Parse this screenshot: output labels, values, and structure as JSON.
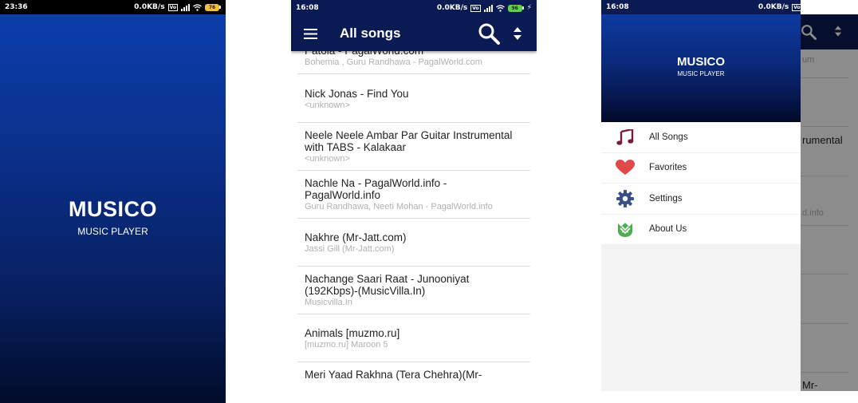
{
  "splash": {
    "status": {
      "time": "23:36",
      "speed": "0.0KB/s",
      "volte": "Vo",
      "battery": "76"
    },
    "title": "MUSICO",
    "subtitle": "MUSIC PLAYER"
  },
  "list": {
    "status": {
      "time": "16:08",
      "speed": "0.0KB/s",
      "volte": "Vo",
      "battery": "96"
    },
    "appbar": {
      "title": "All songs",
      "menu_icon": "hamburger-icon",
      "search_icon": "search-icon",
      "sort_icon": "sort-icon"
    },
    "songs": [
      {
        "title": "Patola - PagalWorld.com",
        "artist": "Bohemia , Guru Randhawa - PagalWorld.com"
      },
      {
        "title": "Nick Jonas - Find You",
        "artist": "<unknown>"
      },
      {
        "title": "Neele Neele Ambar Par Guitar Instrumental with TABS - Kalakaar",
        "artist": "<unknown>"
      },
      {
        "title": "Nachle Na - PagalWorld.info - PagalWorld.info",
        "artist": "Guru Randhawa, Neeti Mohan - PagalWorld.info"
      },
      {
        "title": "Nakhre (Mr-Jatt.com)",
        "artist": "Jassi Gill (Mr-Jatt.com)"
      },
      {
        "title": "Nachange Saari Raat - Junooniyat (192Kbps)-(MusicVilla.In)",
        "artist": "Musicvilla.In"
      },
      {
        "title": "Animals [muzmo.ru]",
        "artist": "[muzmo.ru] Maroon 5"
      },
      {
        "title": "Meri Yaad Rakhna (Tera Chehra)(Mr-",
        "artist": ""
      }
    ]
  },
  "drawer": {
    "status": {
      "time": "16:08",
      "speed": "0.0KB/s",
      "volte": "Vo",
      "battery": "96"
    },
    "title": "MUSICO",
    "subtitle": "MUSIC PLAYER",
    "items": [
      {
        "label": "All Songs",
        "icon": "music-note-icon"
      },
      {
        "label": "Favorites",
        "icon": "heart-icon"
      },
      {
        "label": "Settings",
        "icon": "gear-icon"
      },
      {
        "label": "About Us",
        "icon": "android-logo-icon"
      }
    ],
    "behind": {
      "fragments": [
        "um",
        "rumental",
        "d.info",
        "Mr-"
      ]
    }
  },
  "colors": {
    "primary": "#0a1a52",
    "heart": "#e04a4a",
    "note": "#7a1a3a",
    "gear": "#3a4f8a",
    "android": "#4caf50"
  }
}
